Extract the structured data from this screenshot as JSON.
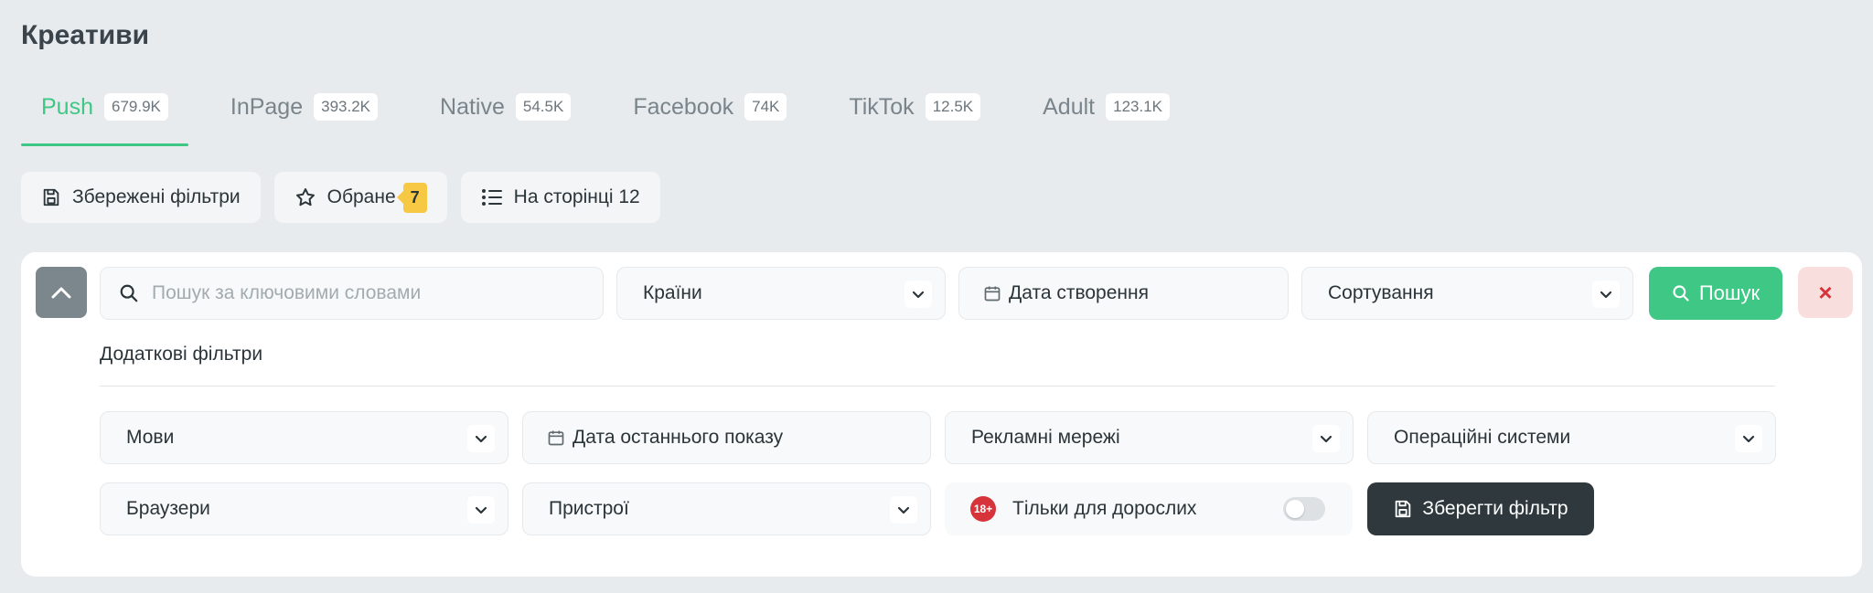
{
  "page": {
    "title": "Креативи"
  },
  "tabs": [
    {
      "label": "Push",
      "count": "679.9K",
      "active": true
    },
    {
      "label": "InPage",
      "count": "393.2K"
    },
    {
      "label": "Native",
      "count": "54.5K"
    },
    {
      "label": "Facebook",
      "count": "74K"
    },
    {
      "label": "TikTok",
      "count": "12.5K"
    },
    {
      "label": "Adult",
      "count": "123.1K"
    }
  ],
  "toolbar": {
    "saved_filters": "Збережені фільтри",
    "favorites": "Обране",
    "favorites_count": "7",
    "per_page": "На сторінці 12"
  },
  "filters": {
    "search_placeholder": "Пошук за ключовими словами",
    "countries": "Країни",
    "created_date": "Дата створення",
    "sorting": "Сортування",
    "search_button": "Пошук",
    "clear_button": "×"
  },
  "extra": {
    "label": "Додаткові фільтри",
    "languages": "Мови",
    "last_shown_date": "Дата останнього показу",
    "ad_networks": "Рекламні мережі",
    "operating_systems": "Операційні системи",
    "browsers": "Браузери",
    "devices": "Пристрої",
    "adult_badge": "18+",
    "adult_only": "Тільки для дорослих",
    "save_filter": "Зберегти фільтр"
  },
  "colors": {
    "accent": "#3fc785",
    "dark": "#2f393d",
    "danger": "#d6343a",
    "badge": "#f7c844"
  }
}
